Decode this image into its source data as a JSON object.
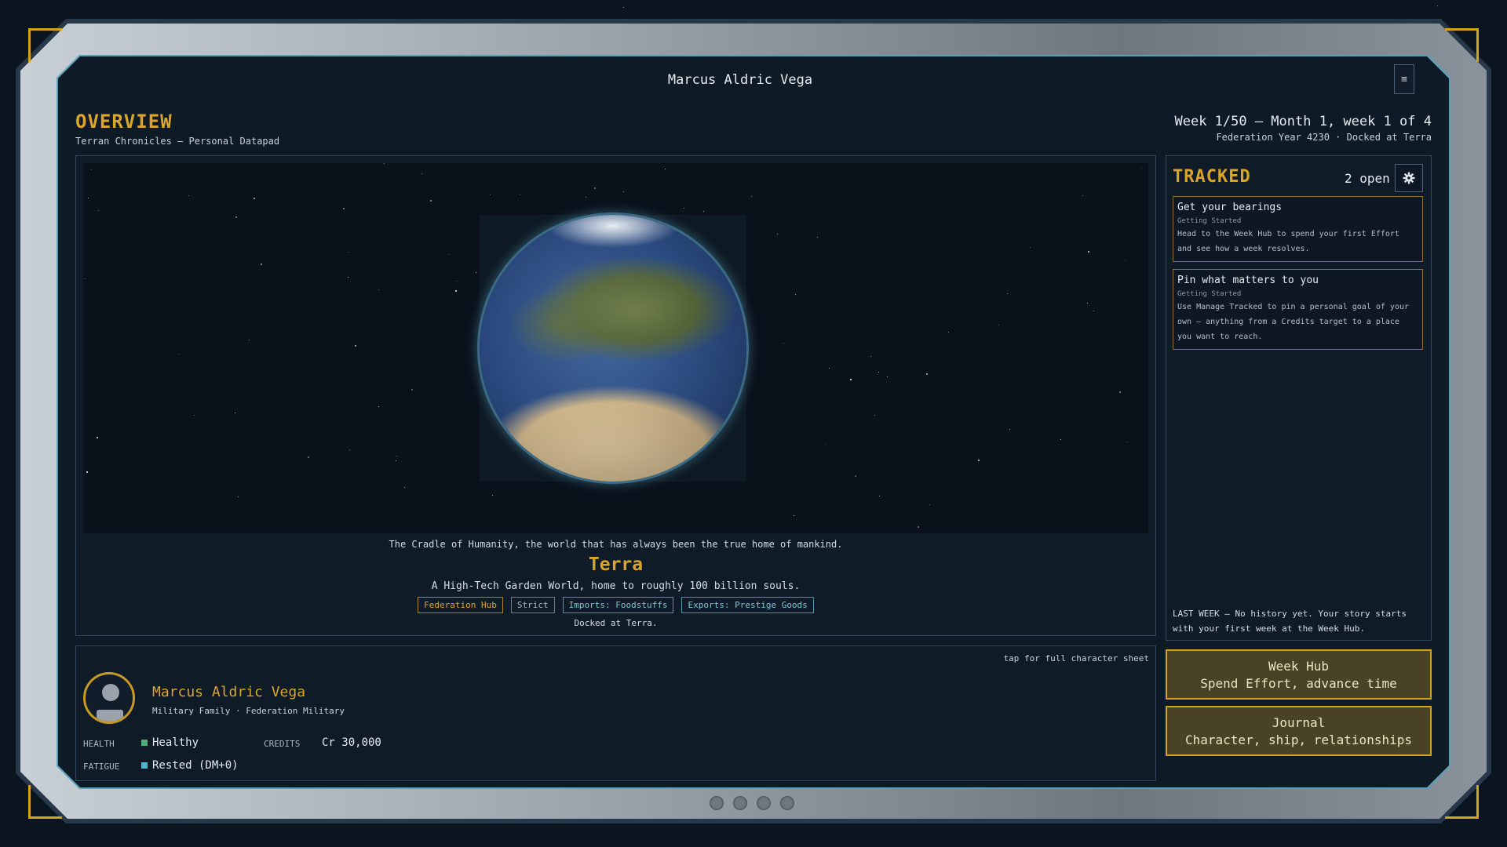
{
  "app": {
    "window_title": "Marcus Aldric Vega",
    "menu_glyph": "≡"
  },
  "header": {
    "title": "OVERVIEW",
    "subtitle": "Terran Chronicles — Personal Datapad",
    "week_line": "Week 1/50 — Month 1, week 1 of 4",
    "year_line": "Federation Year 4230 · Docked at Terra"
  },
  "planet": {
    "tagline": "The Cradle of Humanity, the world that has always been the true home of mankind.",
    "name": "Terra",
    "description": "A High-Tech Garden World, home to roughly 100 billion souls.",
    "tags": [
      {
        "label": "Federation Hub",
        "style": "gold"
      },
      {
        "label": "Strict",
        "style": "grey"
      },
      {
        "label": "Imports: Foodstuffs",
        "style": "teal"
      },
      {
        "label": "Exports: Prestige Goods",
        "style": "teal"
      }
    ],
    "docked": "Docked at Terra."
  },
  "character": {
    "hint": "tap for full character sheet",
    "name": "Marcus Aldric Vega",
    "background": "Military Family · Federation Military",
    "health_label": "HEALTH",
    "health_value": "Healthy",
    "health_color": "#4caf7a",
    "credits_label": "CREDITS",
    "credits_value": "Cr 30,000",
    "fatigue_label": "FATIGUE",
    "fatigue_value": "Rested (DM+0)",
    "fatigue_color": "#4fb3d0"
  },
  "tracked": {
    "title": "TRACKED",
    "count": "2 open",
    "items": [
      {
        "title": "Get your bearings",
        "category": "Getting Started",
        "body": "Head to the Week Hub to spend your first Effort and see how a week resolves."
      },
      {
        "title": "Pin what matters to you",
        "category": "Getting Started",
        "body": "Use Manage Tracked to pin a personal goal of your own — anything from a Credits target to a place you want to reach."
      }
    ],
    "last_week": "LAST WEEK — No history yet. Your story starts with your first week at the Week Hub."
  },
  "actions": {
    "week_hub_line1": "Week Hub",
    "week_hub_line2": "Spend Effort, advance time",
    "journal_line1": "Journal",
    "journal_line2": "Character, ship, relationships"
  },
  "colors": {
    "accent": "#d9a52a",
    "background": "#0a1520"
  }
}
